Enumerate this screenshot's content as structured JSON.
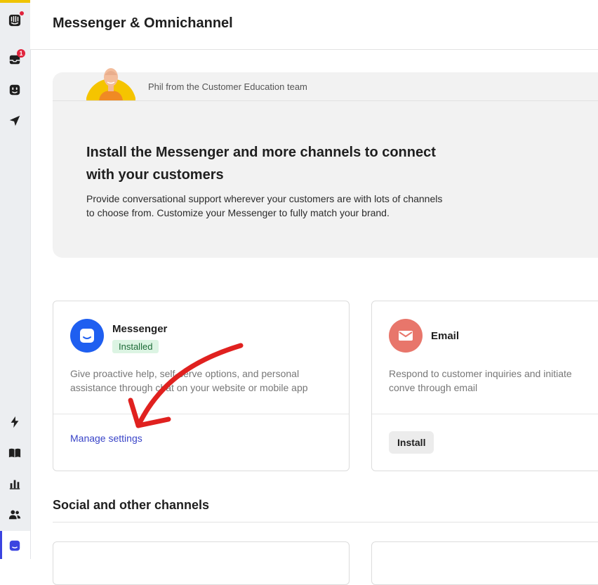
{
  "header": {
    "title": "Messenger & Omnichannel"
  },
  "rail": {
    "icons": [
      "intercom-logo-icon",
      "inbox-icon",
      "fin-bot-icon",
      "outbound-send-icon",
      "automation-bolt-icon",
      "knowledge-book-icon",
      "reports-chart-icon",
      "contacts-people-icon",
      "messenger-icon"
    ],
    "inbox_badge": "1"
  },
  "hero": {
    "caption": "Phil from the Customer Education team",
    "title": "Install the Messenger and more channels to connect with your customers",
    "description": "Provide conversational support wherever your customers are with lots of channels to choose from. Customize your Messenger to fully match your brand."
  },
  "cards": {
    "messenger": {
      "name": "Messenger",
      "status": "Installed",
      "description": "Give proactive help, self-serve options, and personal assistance through chat on your website or mobile app",
      "action": "Manage settings",
      "color": "#1f5ff0"
    },
    "email": {
      "name": "Email",
      "description": "Respond to customer inquiries and initiate conve through email",
      "action": "Install",
      "color": "#e8766b"
    }
  },
  "sections": {
    "social_title": "Social and other channels"
  },
  "colors": {
    "accent": "#3b44e0",
    "annotation_arrow": "#e0211f",
    "success": "#1d6a37"
  }
}
